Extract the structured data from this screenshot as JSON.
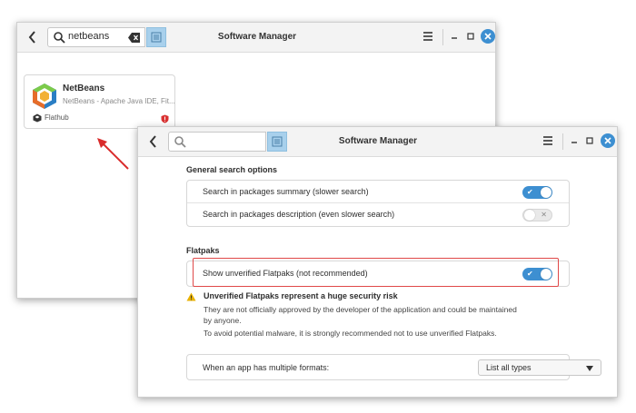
{
  "back_window": {
    "title": "Software Manager",
    "search": {
      "value": "netbeans"
    },
    "app_card": {
      "name": "NetBeans",
      "description": "NetBeans - Apache Java IDE, Fit...",
      "source": "Flathub"
    }
  },
  "front_window": {
    "title": "Software Manager",
    "search": {
      "value": ""
    },
    "general": {
      "heading": "General search options",
      "items": [
        {
          "label": "Search in packages summary (slower search)",
          "enabled": true
        },
        {
          "label": "Search in packages description (even slower search)",
          "enabled": false
        }
      ]
    },
    "flatpaks": {
      "heading": "Flatpaks",
      "items": [
        {
          "label": "Show unverified Flatpaks (not recommended)",
          "enabled": true
        }
      ]
    },
    "warning": {
      "title": "Unverified Flatpaks represent a huge security risk",
      "lines": [
        "They are not officially approved by the developer of the application and could be maintained",
        "by anyone.",
        "To avoid potential malware, it is strongly recommended not to use unverified Flatpaks."
      ]
    },
    "formats": {
      "label": "When an app has multiple formats:",
      "selected": "List all types"
    }
  },
  "colors": {
    "accent": "#3d8fd1",
    "highlight": "#e04848",
    "arrow": "#d92c2c",
    "warning": "#e8b100"
  }
}
